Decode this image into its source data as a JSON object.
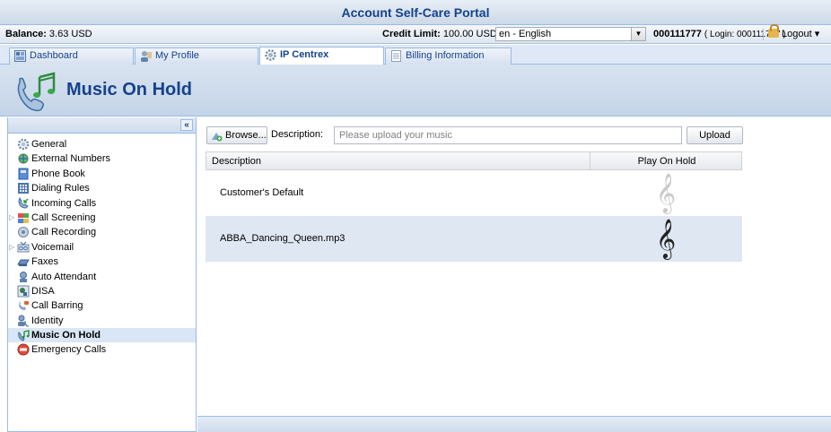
{
  "app": {
    "title": "Account Self-Care Portal"
  },
  "info_bar": {
    "balance_label": "Balance:",
    "balance_value": "3.63 USD",
    "credit_label": "Credit Limit:",
    "credit_value": "100.00 USD",
    "language": "en - English",
    "account_number": "000111777",
    "login_text": "( Login: 000111777 )",
    "logout_label": "Logout",
    "logout_arrow": "▾"
  },
  "tabs": [
    {
      "label": "Dashboard",
      "icon": "dashboard-icon"
    },
    {
      "label": "My Profile",
      "icon": "user-icon"
    },
    {
      "label": "IP Centrex",
      "icon": "gear-icon",
      "active": true
    },
    {
      "label": "Billing Information",
      "icon": "document-icon"
    }
  ],
  "page_header": {
    "title": "Music On Hold",
    "icon": "phone-music-icon"
  },
  "sidebar": {
    "collapse_label": "«",
    "items": [
      {
        "label": "General",
        "icon": "gear-icon"
      },
      {
        "label": "External Numbers",
        "icon": "network-icon"
      },
      {
        "label": "Phone Book",
        "icon": "book-icon"
      },
      {
        "label": "Dialing Rules",
        "icon": "keypad-icon"
      },
      {
        "label": "Incoming Calls",
        "icon": "incoming-call-icon"
      },
      {
        "label": "Call Screening",
        "icon": "screening-icon",
        "expandable": true
      },
      {
        "label": "Call Recording",
        "icon": "recording-icon"
      },
      {
        "label": "Voicemail",
        "icon": "voicemail-icon",
        "expandable": true
      },
      {
        "label": "Faxes",
        "icon": "fax-icon"
      },
      {
        "label": "Auto Attendant",
        "icon": "attendant-icon"
      },
      {
        "label": "DISA",
        "icon": "disa-icon"
      },
      {
        "label": "Call Barring",
        "icon": "barring-icon"
      },
      {
        "label": "Identity",
        "icon": "identity-icon"
      },
      {
        "label": "Music On Hold",
        "icon": "music-icon",
        "selected": true
      },
      {
        "label": "Emergency Calls",
        "icon": "emergency-icon"
      }
    ]
  },
  "toolbar": {
    "browse_label": "Browse...",
    "description_label": "Description:",
    "description_placeholder": "Please upload your music",
    "upload_label": "Upload"
  },
  "grid": {
    "columns": [
      "Description",
      "Play On Hold"
    ],
    "rows": [
      {
        "description": "Customer's Default",
        "play_on_hold": false
      },
      {
        "description": "ABBA_Dancing_Queen.mp3",
        "play_on_hold": true
      }
    ],
    "clef_symbol": "𝄞"
  }
}
